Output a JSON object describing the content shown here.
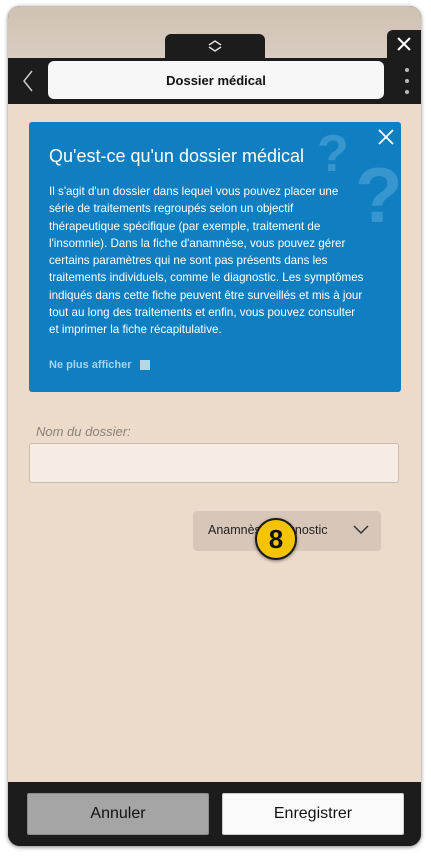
{
  "header": {
    "title": "Dossier médical",
    "handle_icon": "chevron-up-down-icon",
    "close_icon": "close-icon",
    "back_icon": "chevron-left-icon",
    "more_icon": "more-vertical-icon"
  },
  "info_panel": {
    "title": "Qu'est-ce qu'un dossier médical",
    "text": "Il s'agit d'un dossier dans lequel vous pouvez placer une série de traitements regroupés selon un objectif thérapeutique spécifique (par exemple, traitement de l'insomnie). Dans la fiche d'anamnèse, vous pouvez gérer certains paramètres qui ne sont pas présents dans les traitements individuels, comme le diagnostic. Les symptômes indiqués dans cette fiche peuvent être surveillés et mis à jour tout au long des traitements et enfin, vous pouvez consulter et imprimer la fiche récapitulative.",
    "dont_show_label": "Ne plus afficher",
    "accent_color": "#0f7fc2"
  },
  "form": {
    "name_label": "Nom du dossier:",
    "name_value": "",
    "dropdown_label": "Anamnèse/diagnostic"
  },
  "badge": {
    "number": "8"
  },
  "footer": {
    "cancel_label": "Annuler",
    "save_label": "Enregistrer"
  }
}
